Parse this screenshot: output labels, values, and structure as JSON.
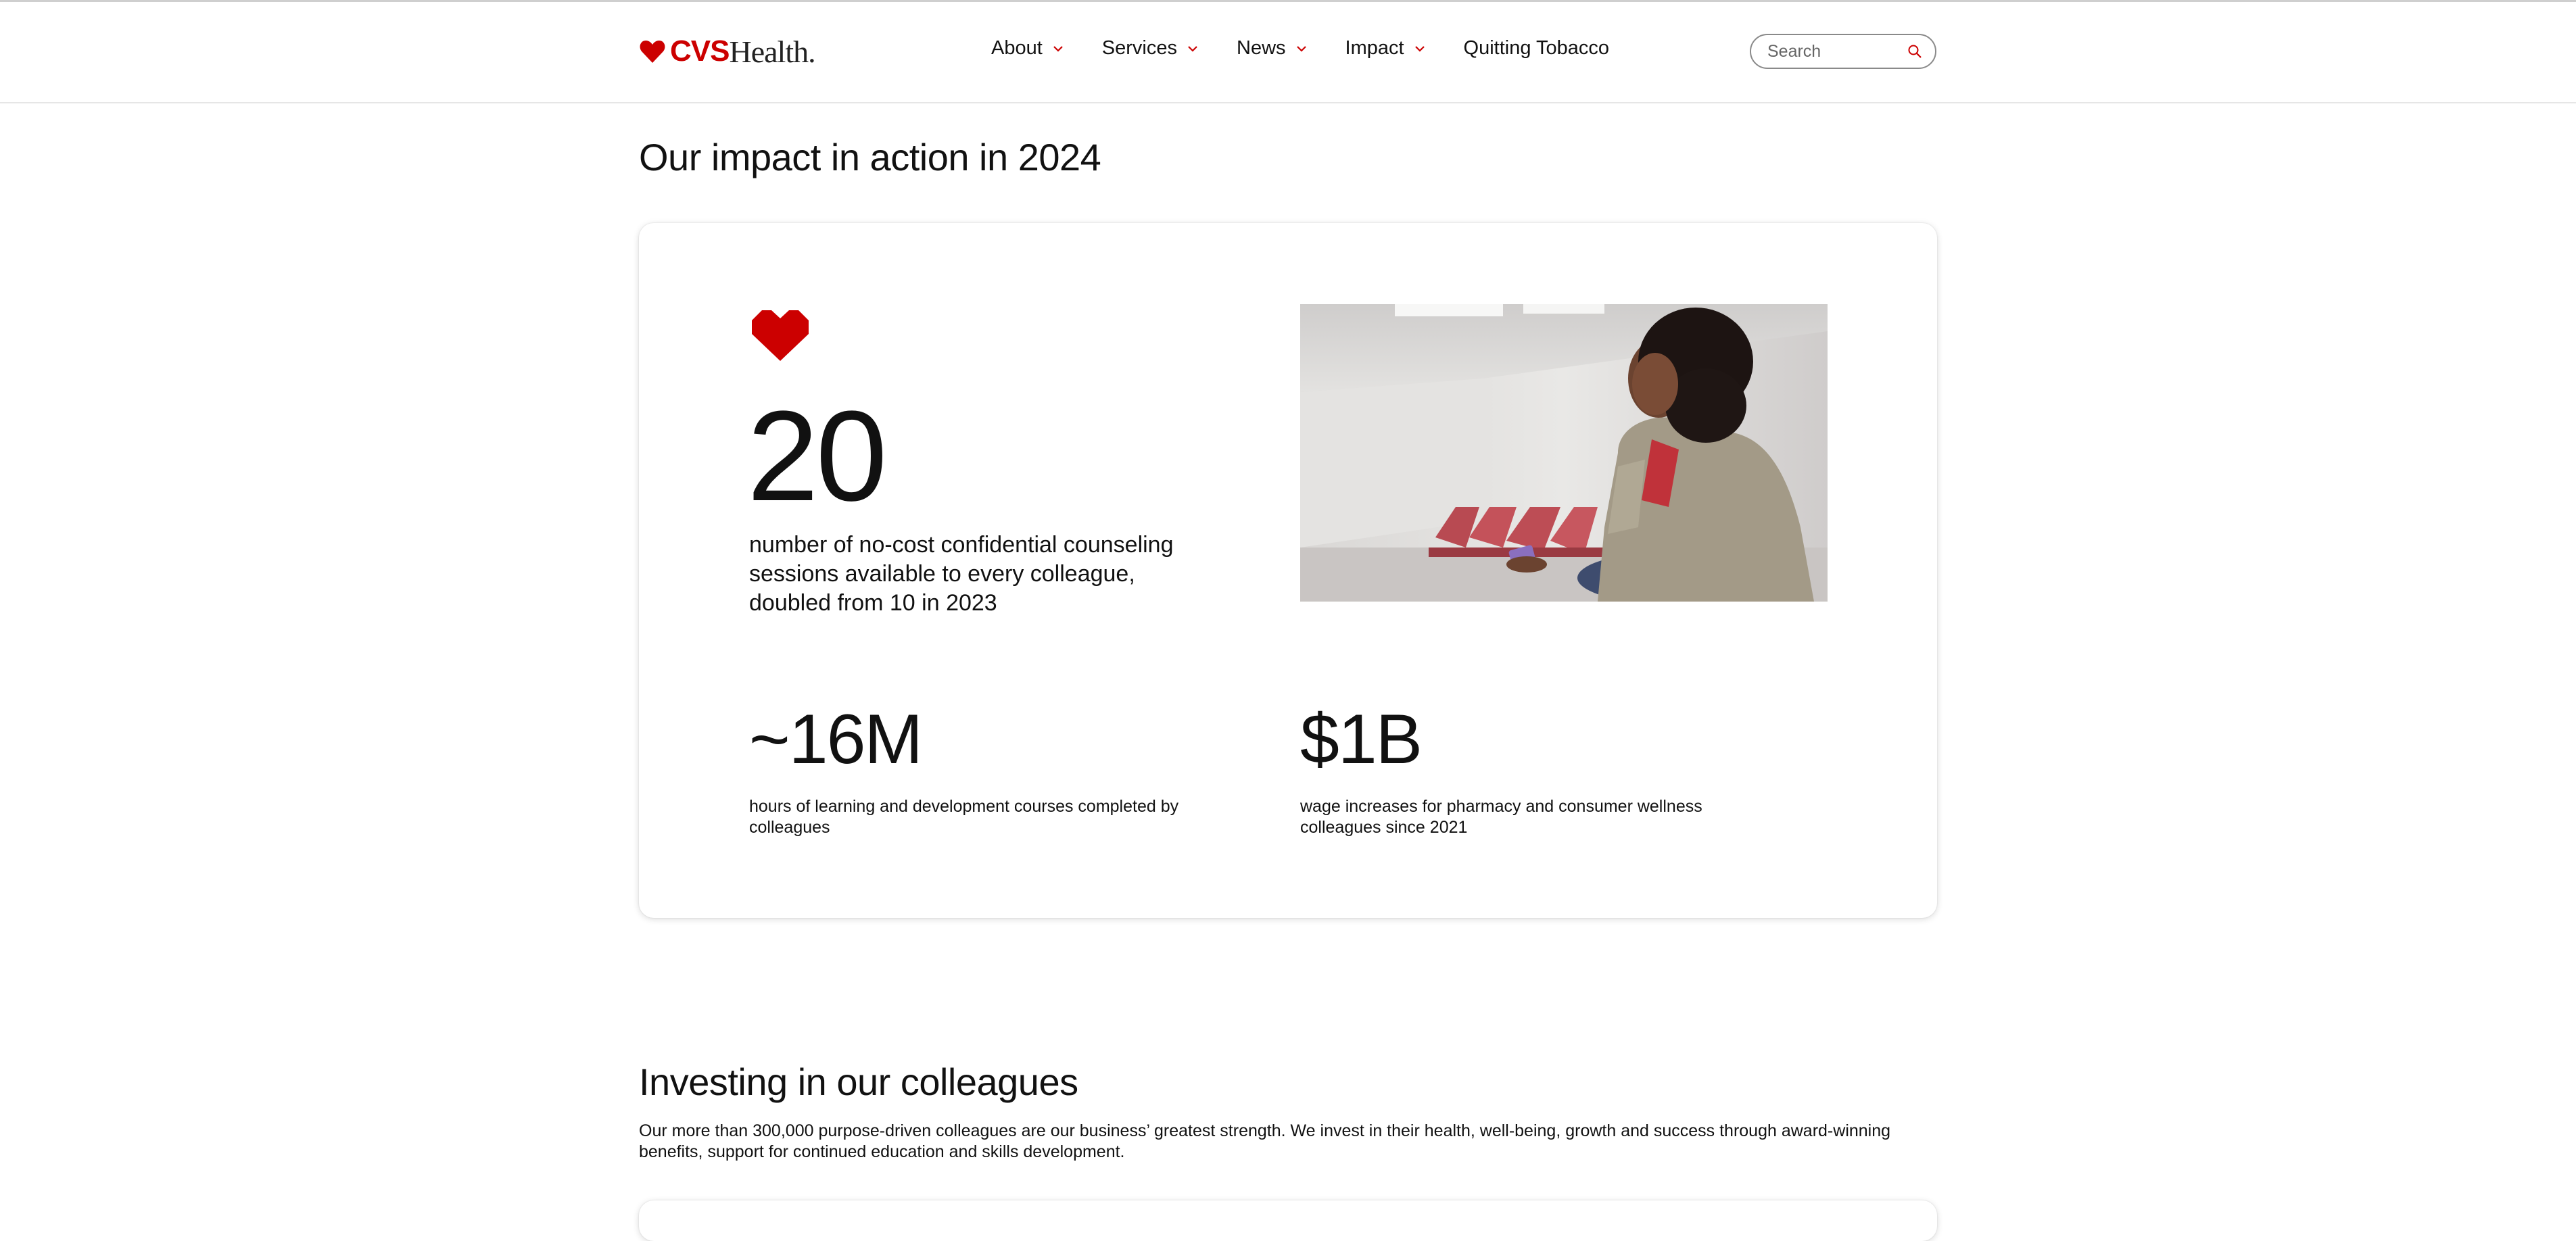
{
  "colors": {
    "brand_red": "#cc0000",
    "text": "#111111",
    "divider": "#e6e6e6"
  },
  "header": {
    "logo": {
      "icon": "heart-icon",
      "cvs": "CVS",
      "health": "Health."
    },
    "nav": [
      {
        "label": "About",
        "has_dropdown": true
      },
      {
        "label": "Services",
        "has_dropdown": true
      },
      {
        "label": "News",
        "has_dropdown": true
      },
      {
        "label": "Impact",
        "has_dropdown": true
      },
      {
        "label": "Quitting Tobacco",
        "has_dropdown": false
      }
    ],
    "search": {
      "placeholder": "Search",
      "icon": "search-icon"
    }
  },
  "impact": {
    "heading": "Our impact in action in 2024",
    "main_stat": {
      "icon": "heart-icon",
      "value": "20",
      "description": "number of no-cost confidential counseling sessions available to every colleague, doubled from 10 in 2023"
    },
    "photo_alt": "Woman seated in a waiting room looking at her phone",
    "stats": [
      {
        "value": "~16M",
        "description": "hours of learning and development courses completed by colleagues"
      },
      {
        "value": "$1B",
        "description": "wage increases for pharmacy and consumer wellness colleagues since 2021"
      }
    ]
  },
  "investing": {
    "heading": "Investing in our colleagues",
    "body": "Our more than 300,000 purpose-driven colleagues are our business’ greatest strength. We invest in their health, well-being, growth and success through award-winning benefits, support for continued education and skills development."
  }
}
